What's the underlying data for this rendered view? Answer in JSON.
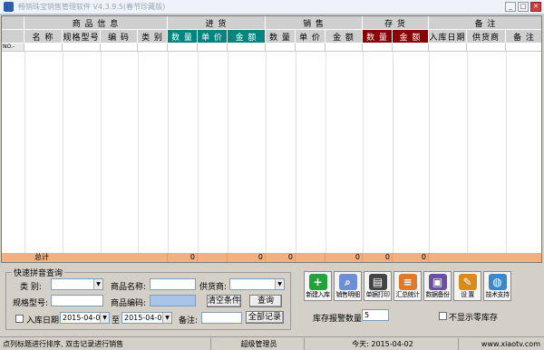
{
  "window": {
    "title": "畅销珠宝销售管理软件 V4.3.9.5(春节珍藏版)",
    "min": "_",
    "max": "□",
    "close": "✕"
  },
  "grid": {
    "groups": [
      "商 品 信 息",
      "进 货",
      "销 售",
      "存 货",
      "备 注"
    ],
    "columns": [
      "名 称",
      "规格型号",
      "编 码",
      "类 别",
      "数 量",
      "单 价",
      "金 额",
      "数 量",
      "单 价",
      "金 额",
      "数 量",
      "金 额",
      "入库日期",
      "供货商",
      "备 注"
    ],
    "row_no": "NO.-",
    "total_label": "总计",
    "totals": [
      "0",
      "0",
      "0",
      "0",
      "0",
      "0"
    ]
  },
  "search": {
    "legend": "快速拼音查询",
    "category_label": "类 别:",
    "product_name_label": "商品名称:",
    "supplier_label": "供货商:",
    "spec_label": "规格型号:",
    "code_label": "商品编码:",
    "clear_button": "清空条件",
    "query_button": "查询",
    "date_label": "入库日期:",
    "date_from": "2015-04-02",
    "to_label": "至",
    "date_to": "2015-04-02",
    "remark_label": "备注:",
    "all_records_button": "全部记录"
  },
  "toolbar": [
    "新建入库",
    "销售明细",
    "单据打印",
    "汇总统计",
    "数据备份",
    "设 置",
    "技术支持"
  ],
  "stock_alert": {
    "label": "库存报警数量:",
    "value": "5",
    "hide_zero_label": "不显示零库存"
  },
  "status": {
    "hint": "点列标题进行排序, 双击记录进行销售",
    "user": "超级管理员",
    "today": "今天: 2015-04-02",
    "website": "www.xiaotv.com"
  },
  "colors": {
    "teal": "#00847f",
    "darkred": "#8b0000",
    "total": "#f3b07c"
  }
}
